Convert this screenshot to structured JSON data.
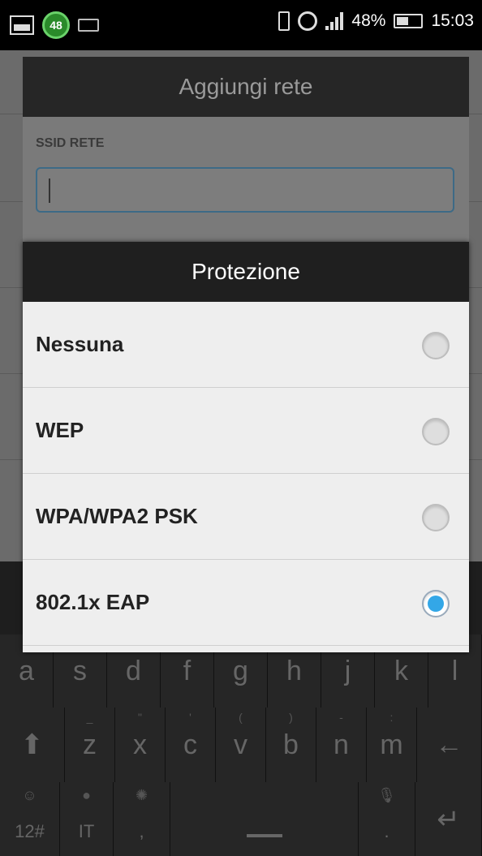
{
  "status_bar": {
    "notification_count": "48",
    "battery_percent": "48%",
    "time": "15:03"
  },
  "background_dialog": {
    "title": "Aggiungi rete",
    "ssid_label": "SSID RETE",
    "ssid_value": ""
  },
  "protection_dialog": {
    "title": "Protezione",
    "options": [
      {
        "label": "Nessuna",
        "selected": false
      },
      {
        "label": "WEP",
        "selected": false
      },
      {
        "label": "WPA/WPA2 PSK",
        "selected": false
      },
      {
        "label": "802.1x EAP",
        "selected": true
      }
    ]
  },
  "keyboard": {
    "row_home": [
      "a",
      "s",
      "d",
      "f",
      "g",
      "h",
      "j",
      "k",
      "l"
    ],
    "row_bottom_letters": [
      "z",
      "x",
      "c",
      "v",
      "b",
      "n",
      "m"
    ],
    "row_bottom_subs": [
      "_",
      "\"",
      "'",
      "(",
      ")",
      "-",
      ":"
    ],
    "symbols_key": "12#",
    "language_key": "IT",
    "comma_key": ",",
    "period_key": "."
  },
  "colors": {
    "accent": "#33a7e7",
    "dialog_title_bg": "#1f1f1f",
    "dialog_bg": "#eeeeee"
  }
}
